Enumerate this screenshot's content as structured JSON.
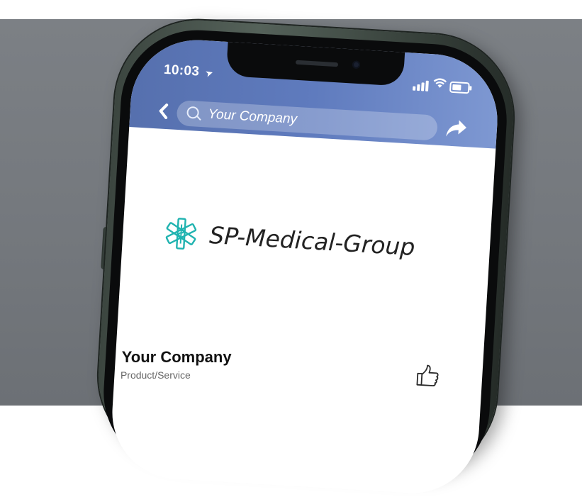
{
  "status_bar": {
    "time": "10:03"
  },
  "app_bar": {
    "search_value": "Your Company"
  },
  "page": {
    "logo_text": "SP-Medical-Group",
    "company_name": "Your Company",
    "category": "Product/Service"
  },
  "icons": {
    "back": "chevron-left-icon",
    "search": "search-icon",
    "share": "share-arrow-icon",
    "like": "thumbs-up-icon",
    "logo": "star-of-life-icon"
  },
  "colors": {
    "app_bar": "#5f7bbe",
    "logo": "#20b3b0",
    "backdrop": "#74787d"
  }
}
